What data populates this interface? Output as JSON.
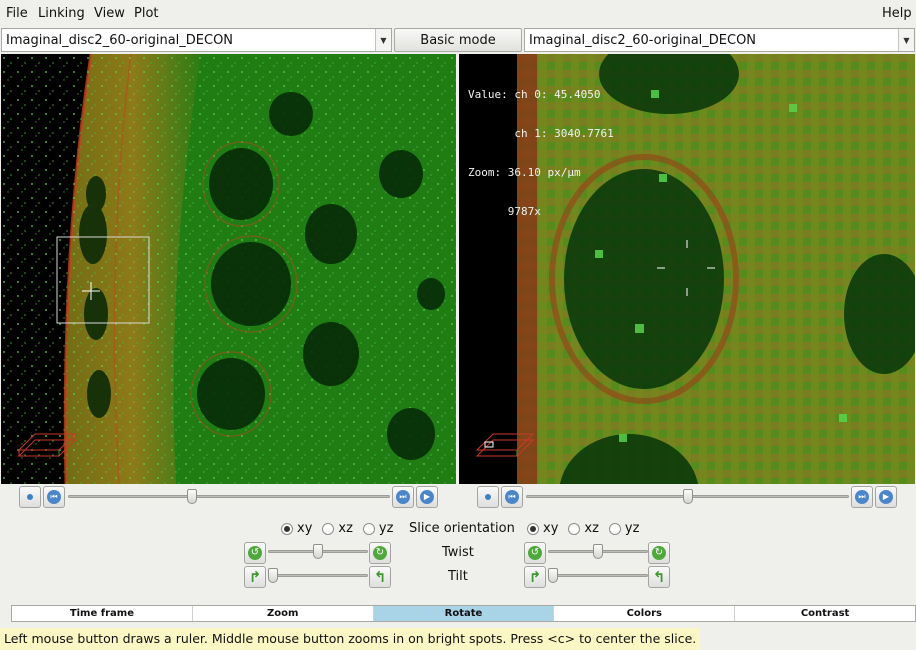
{
  "menubar": {
    "file": "File",
    "linking": "Linking",
    "view": "View",
    "plot": "Plot",
    "help": "Help"
  },
  "left_dataset": "Imaginal_disc2_60-original_DECON",
  "right_dataset": "Imaginal_disc2_60-original_DECON",
  "mode_button": "Basic mode",
  "overlay": {
    "value_line1": "Value: ch 0: 45.4050",
    "value_line2": "       ch 1: 3040.7761",
    "zoom_line1": "Zoom: 36.10 px/µm",
    "zoom_line2": "      9787x"
  },
  "orientation": {
    "label": "Slice orientation",
    "options": [
      "xy",
      "xz",
      "yz"
    ],
    "left_selected": "xy",
    "right_selected": "xy"
  },
  "twist_label": "Twist",
  "tilt_label": "Tilt",
  "sliders": {
    "left_time": 0.38,
    "right_time": 0.5,
    "left_twist": 0.5,
    "right_twist": 0.5,
    "left_tilt": 0.0,
    "right_tilt": 0.0
  },
  "tabs": [
    {
      "label": "Time frame",
      "active": false
    },
    {
      "label": "Zoom",
      "active": false
    },
    {
      "label": "Rotate",
      "active": true
    },
    {
      "label": "Colors",
      "active": false
    },
    {
      "label": "Contrast",
      "active": false
    }
  ],
  "status_text": "Left mouse button draws a ruler. Middle mouse button zooms in on bright spots. Press <c> to center the slice.",
  "colors": {
    "active_tab": "#a9d3e6",
    "status_bg": "#fbf7c4",
    "green_channel": "#1aa31a",
    "red_channel": "#b8361c"
  }
}
